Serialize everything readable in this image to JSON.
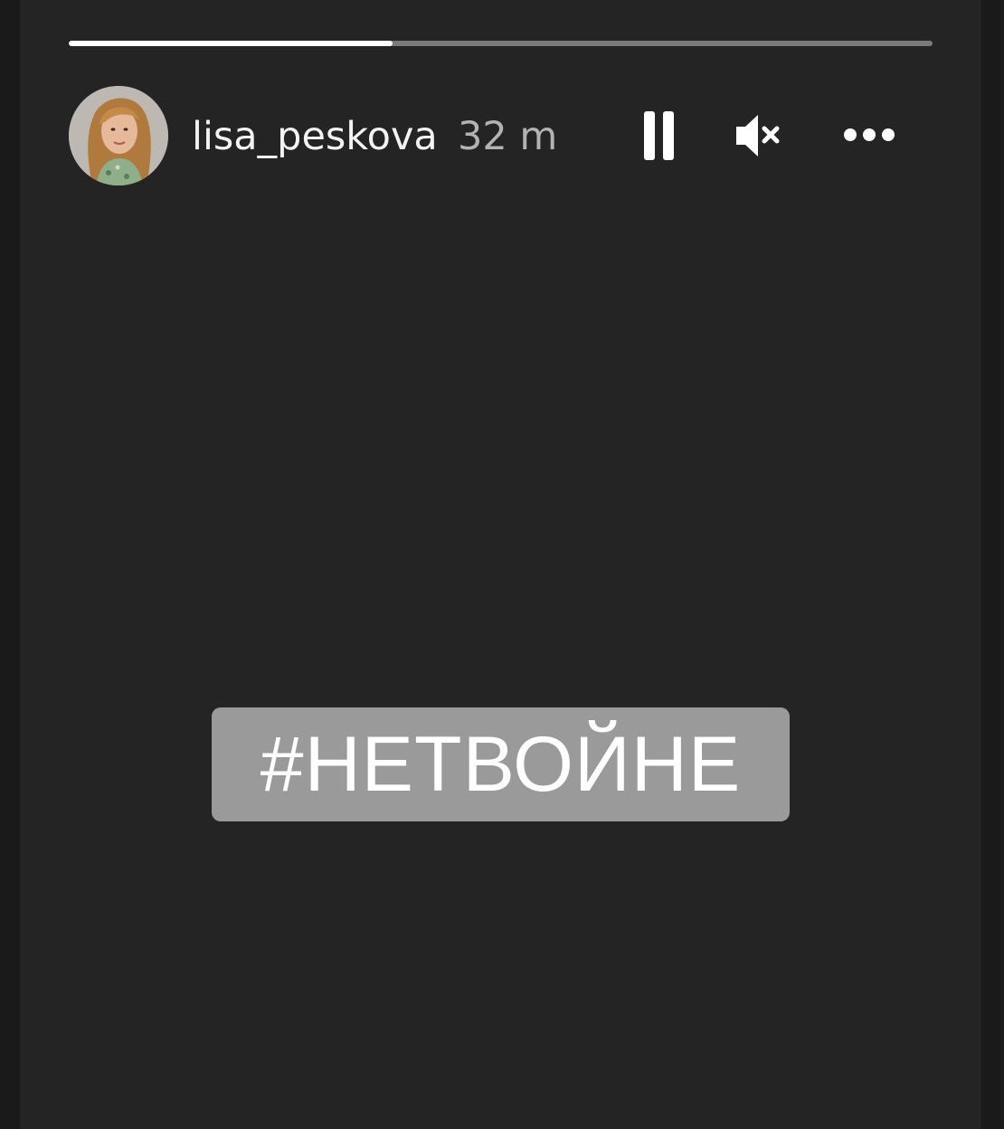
{
  "story": {
    "progress_fraction": 0.375,
    "author": {
      "username": "lisa_peskova",
      "avatar_icon": "profile-photo"
    },
    "timestamp": "32 m",
    "controls": {
      "pause_icon": "pause-icon",
      "mute_icon": "speaker-muted-icon",
      "more_icon": "more-options-icon"
    },
    "sticker_text": "#НЕТВОЙНЕ"
  },
  "colors": {
    "background": "#242424",
    "progress_track": "#7a7a7a",
    "progress_fill": "#ffffff",
    "sticker_background": "#9a9a9a",
    "username_text": "#f3f3f3",
    "timestamp_text": "#b3b3b3"
  }
}
